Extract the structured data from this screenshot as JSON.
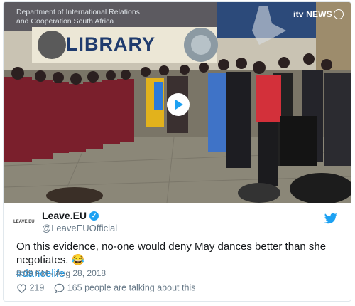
{
  "video": {
    "department_text": "Department of International Relations and Cooperation South Africa",
    "library_sign": "LIBRARY",
    "broadcaster": "itv NEWS",
    "play_icon": "play-icon"
  },
  "tweet": {
    "avatar_text": "LEAVE.EU",
    "display_name": "Leave.EU",
    "handle": "@LeaveEUOfficial",
    "verified_icon": "verified-badge-icon",
    "brand_icon": "twitter-bird-icon",
    "text": "On this evidence, no-one would deny May dances better than she negotiates. 😂",
    "hashtag": "#dancelife",
    "timestamp": "8:09 PM - Aug 28, 2018",
    "likes": "219",
    "talking": "165 people are talking about this",
    "like_icon": "heart-icon",
    "reply_icon": "speech-bubble-icon"
  },
  "colors": {
    "accent": "#1da1f2",
    "text": "#14171a",
    "muted": "#657786"
  }
}
